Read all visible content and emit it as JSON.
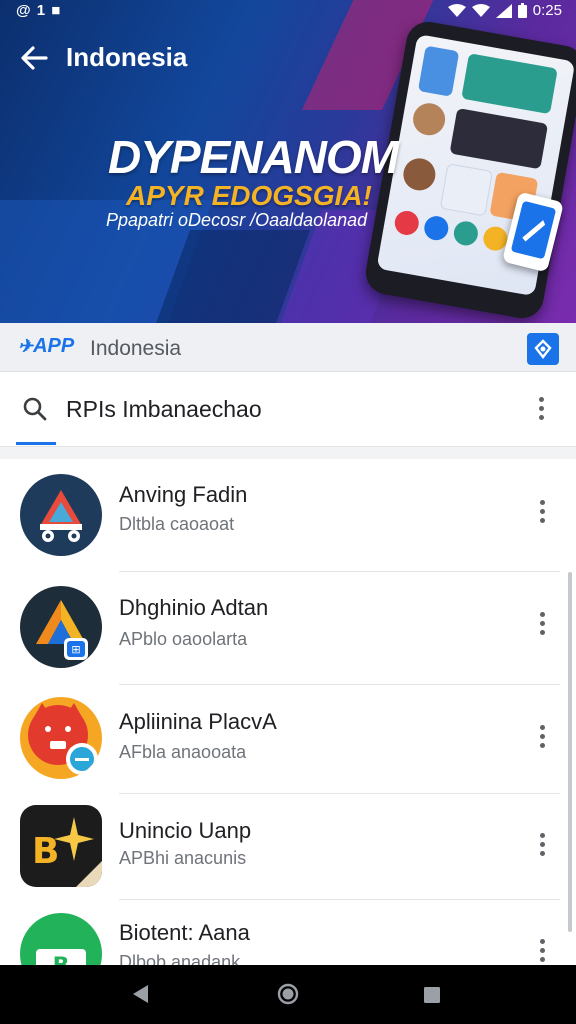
{
  "status_bar": {
    "left_text": "@ 1 ■",
    "time": "0:25"
  },
  "app_bar": {
    "title": "Indonesia",
    "back_icon": "arrow-back-icon"
  },
  "banner": {
    "headline": "DYPENANOM",
    "subheadline": "APYR EDOGSGIA!",
    "tagline": "Ppapatri oDecosr /Oaaldaolanad"
  },
  "sub_bar": {
    "logo_text": "APP",
    "country": "Indonesia",
    "action_icon": "diamond-badge-icon"
  },
  "search": {
    "value": "RPIs Imbanaechao",
    "icon": "search-icon",
    "more_icon": "more-vert-icon"
  },
  "apps": [
    {
      "name": "Anving Fadin",
      "subtitle": "Dltbla caoaoat"
    },
    {
      "name": "Dhghinio Adtan",
      "subtitle": "APblo oaoolarta"
    },
    {
      "name": "Apliinina PlacvA",
      "subtitle": "AFbla anaooata"
    },
    {
      "name": "Unincio Uanp",
      "subtitle": "APBhi anacunis"
    },
    {
      "name": "Biotent: Aana",
      "subtitle": "Dlbob anadank"
    }
  ],
  "nav_bar": {
    "back": "nav-back-icon",
    "home": "nav-home-icon",
    "recents": "nav-recents-icon"
  },
  "colors": {
    "accent": "#1a73e8",
    "banner_gold": "#f3b324"
  }
}
